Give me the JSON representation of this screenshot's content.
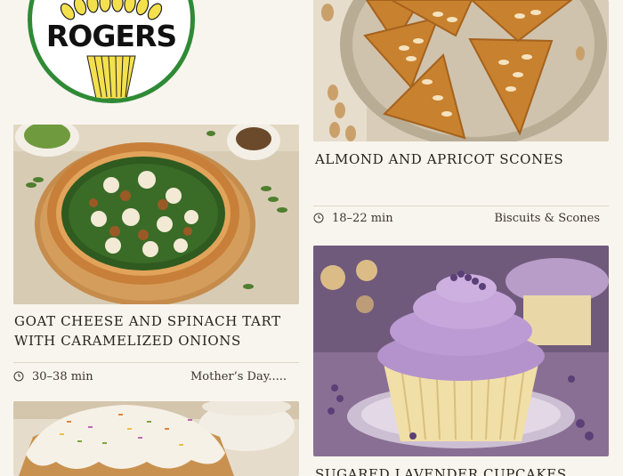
{
  "logo": {
    "text": "ROGERS",
    "ring_color": "#2f8a36",
    "wheat_color": "#f4e04d"
  },
  "recipes": [
    {
      "title": "Almond and Apricot Scones",
      "time": "18–22 min",
      "category": "Biscuits & Scones",
      "icon": "clock-icon"
    },
    {
      "title": "Goat Cheese and Spinach Tart with Caramelized Onions",
      "time": "30–38 min",
      "category": "Mother’s Day.....",
      "icon": "clock-icon"
    },
    {
      "title": "Sugared Lavender Cupcakes"
    },
    {
      "title": ""
    }
  ]
}
